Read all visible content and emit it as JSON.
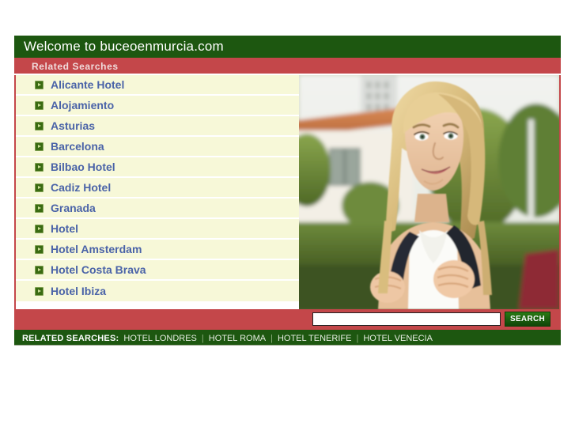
{
  "header": {
    "title": "Welcome to buceoenmurcia.com"
  },
  "subbar": {
    "label": "Related Searches"
  },
  "links": [
    {
      "label": "Alicante Hotel",
      "icon": "arrow-bullet-icon"
    },
    {
      "label": "Alojamiento",
      "icon": "arrow-bullet-icon"
    },
    {
      "label": "Asturias",
      "icon": "arrow-bullet-icon"
    },
    {
      "label": "Barcelona",
      "icon": "arrow-bullet-icon"
    },
    {
      "label": "Bilbao Hotel",
      "icon": "arrow-bullet-icon"
    },
    {
      "label": "Cadiz Hotel",
      "icon": "arrow-bullet-icon"
    },
    {
      "label": "Granada",
      "icon": "arrow-bullet-icon"
    },
    {
      "label": "Hotel",
      "icon": "arrow-bullet-icon"
    },
    {
      "label": "Hotel Amsterdam",
      "icon": "arrow-bullet-icon"
    },
    {
      "label": "Hotel Costa Brava",
      "icon": "arrow-bullet-icon"
    },
    {
      "label": "Hotel Ibiza",
      "icon": "arrow-bullet-icon"
    }
  ],
  "photo": {
    "alt": "Smiling blonde woman with backpack outdoors in front of a villa and hedge"
  },
  "search": {
    "value": "",
    "placeholder": "",
    "button_label": "SEARCH"
  },
  "footer": {
    "label": "RELATED SEARCHES:",
    "links": [
      "HOTEL LONDRES",
      "HOTEL ROMA",
      "HOTEL TENERIFE",
      "HOTEL VENECIA"
    ],
    "separator": "|"
  },
  "colors": {
    "green_dark": "#1d5710",
    "red": "#c4474a",
    "link_blue": "#4a63a8",
    "row_cream": "#f7f8d8",
    "bullet_green": "#3a6b12"
  }
}
